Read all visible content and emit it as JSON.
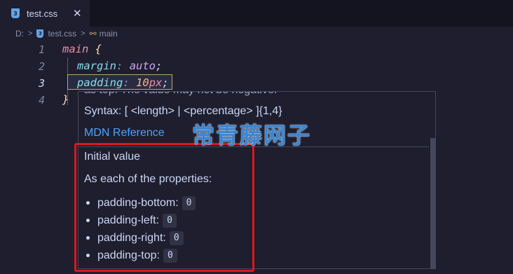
{
  "tab": {
    "file_icon_glyph": "3",
    "title": "test.css",
    "close_glyph": "✕"
  },
  "breadcrumb": {
    "drive": "D:",
    "sep": ">",
    "file_icon_glyph": "3",
    "file": "test.css",
    "symbol_icon_glyph": "⚯",
    "symbol": "main"
  },
  "editor": {
    "line_numbers": [
      "1",
      "2",
      "3",
      "4"
    ],
    "line1": {
      "selector": "main",
      "brace": "{"
    },
    "line2": {
      "property": "margin",
      "colon": ":",
      "value": "auto",
      "semi": ";"
    },
    "line3": {
      "property": "padding",
      "colon": ":",
      "number": "10",
      "unit": "px",
      "semi": ";"
    },
    "line4": {
      "brace": "}"
    }
  },
  "hover": {
    "clipped_text": "as top. The value may not be negative.",
    "syntax": "Syntax: [ <length> | <percentage> ]{1,4}",
    "mdn_link": "MDN Reference",
    "initial_title": "Initial value",
    "initial_desc": "As each of the properties:",
    "items": [
      {
        "name": "padding-bottom:",
        "value": "0"
      },
      {
        "name": "padding-left:",
        "value": "0"
      },
      {
        "name": "padding-right:",
        "value": "0"
      },
      {
        "name": "padding-top:",
        "value": "0"
      }
    ]
  },
  "watermark": "常青藤网子",
  "colors": {
    "background": "#1e1e2e",
    "link": "#4aa3ff",
    "annotation": "#e0161c",
    "watermark": "#3d8ee0"
  },
  "icons": {
    "tab_file": "css-file-icon",
    "tab_close": "close-icon",
    "breadcrumb_symbol": "symbol-icon"
  }
}
